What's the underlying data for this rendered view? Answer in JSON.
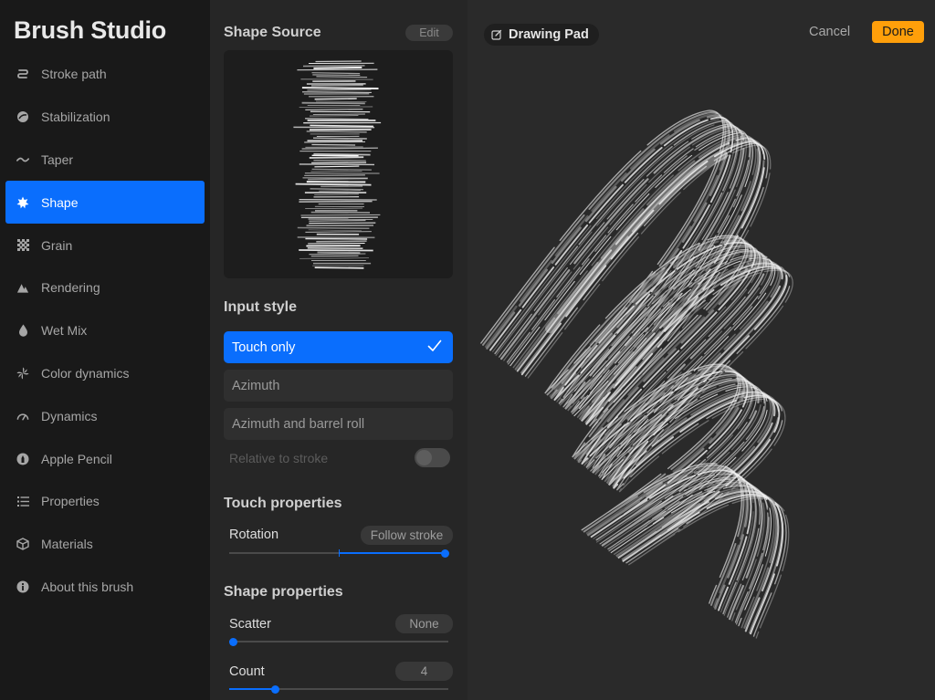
{
  "app": {
    "title": "Brush Studio"
  },
  "sidebar": {
    "items": [
      {
        "label": "Stroke path",
        "icon": "stroke-path-icon"
      },
      {
        "label": "Stabilization",
        "icon": "stabilization-icon"
      },
      {
        "label": "Taper",
        "icon": "taper-icon"
      },
      {
        "label": "Shape",
        "icon": "shape-icon",
        "active": true
      },
      {
        "label": "Grain",
        "icon": "grain-icon"
      },
      {
        "label": "Rendering",
        "icon": "rendering-icon"
      },
      {
        "label": "Wet Mix",
        "icon": "wet-mix-icon"
      },
      {
        "label": "Color dynamics",
        "icon": "color-dynamics-icon"
      },
      {
        "label": "Dynamics",
        "icon": "dynamics-icon"
      },
      {
        "label": "Apple Pencil",
        "icon": "apple-pencil-icon"
      },
      {
        "label": "Properties",
        "icon": "properties-icon"
      },
      {
        "label": "Materials",
        "icon": "materials-icon"
      },
      {
        "label": "About this brush",
        "icon": "about-icon"
      }
    ]
  },
  "panel": {
    "shape_source": {
      "title": "Shape Source",
      "edit_label": "Edit"
    },
    "input_style": {
      "title": "Input style",
      "options": [
        {
          "label": "Touch only",
          "selected": true
        },
        {
          "label": "Azimuth",
          "selected": false
        },
        {
          "label": "Azimuth and barrel roll",
          "selected": false
        }
      ],
      "relative_to_stroke": {
        "label": "Relative to stroke",
        "enabled": false
      }
    },
    "touch_properties": {
      "title": "Touch properties",
      "rotation": {
        "label": "Rotation",
        "value": "Follow stroke",
        "slider_fraction": 1.0
      }
    },
    "shape_properties": {
      "title": "Shape properties",
      "scatter": {
        "label": "Scatter",
        "value": "None",
        "slider_fraction": 0.0
      },
      "count": {
        "label": "Count",
        "value": "4",
        "slider_fraction": 0.2
      }
    }
  },
  "canvas": {
    "pad_label": "Drawing Pad",
    "cancel_label": "Cancel",
    "done_label": "Done"
  },
  "colors": {
    "accent": "#0a6efd",
    "done": "#ff9f0a",
    "sidebar_bg": "#191919",
    "panel_bg": "#262626",
    "canvas_bg": "#2a2a2a"
  }
}
